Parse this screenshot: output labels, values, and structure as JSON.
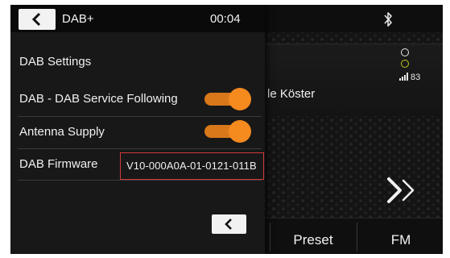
{
  "header": {
    "title": "DAB+",
    "time": "00:04"
  },
  "settings": {
    "section_title": "DAB Settings",
    "rows": [
      {
        "label": "DAB - DAB Service Following",
        "type": "toggle",
        "state": "on"
      },
      {
        "label": "Antenna Supply",
        "type": "toggle",
        "state": "on"
      },
      {
        "label": "DAB Firmware",
        "type": "value",
        "value": "V10-000A0A-01-0121-011B"
      }
    ]
  },
  "background_app": {
    "artist_text": "le Köster",
    "signal_strength": "83",
    "bottom_buttons": [
      "Preset",
      "FM"
    ]
  },
  "icons": {
    "back": "chevron-left-icon",
    "bluetooth": "bluetooth-icon",
    "skip": "double-chevron-right-icon",
    "signal": "signal-bars-icon"
  },
  "colors": {
    "toggle_on": "#f58a1f",
    "highlight_box": "#d33a3a",
    "panel_bg": "#181818"
  }
}
